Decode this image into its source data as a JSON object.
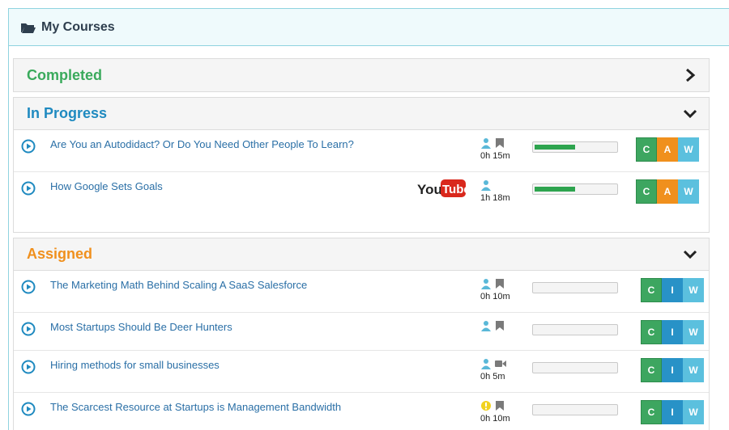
{
  "header": {
    "title": "My Courses"
  },
  "sections": {
    "completed": {
      "title": "Completed",
      "color": "#3aaa5c"
    },
    "in_progress": {
      "title": "In Progress",
      "color": "#1f8ac0",
      "rows": [
        {
          "title": "Are You an Autodidact? Or Do You Need Other People To Learn?",
          "duration": "0h 15m",
          "progress": 0.5,
          "buttons": [
            "C",
            "A",
            "W"
          ]
        },
        {
          "title": "How Google Sets Goals",
          "duration": "1h 18m",
          "progress": 0.5,
          "buttons": [
            "C",
            "A",
            "W"
          ],
          "youtube_label": {
            "you": "You",
            "tube": "Tube"
          }
        }
      ]
    },
    "assigned": {
      "title": "Assigned",
      "color": "#f0901d",
      "rows": [
        {
          "title": "The Marketing Math Behind Scaling A SaaS Salesforce",
          "duration": "0h 10m",
          "progress": 0,
          "buttons": [
            "C",
            "I",
            "W"
          ],
          "icon2": "bookmark-icon"
        },
        {
          "title": "Most Startups Should Be Deer Hunters",
          "duration": "",
          "progress": 0,
          "buttons": [
            "C",
            "I",
            "W"
          ],
          "icon2": "bookmark-icon"
        },
        {
          "title": "Hiring methods for small businesses",
          "duration": "0h 5m",
          "progress": 0,
          "buttons": [
            "C",
            "I",
            "W"
          ],
          "icon2": "video-camera-icon"
        },
        {
          "title": "The Scarcest Resource at Startups is Management Bandwidth",
          "duration": "0h 10m",
          "progress": 0,
          "buttons": [
            "C",
            "I",
            "W"
          ],
          "icon1": "warning-circle-icon",
          "icon2": "bookmark-icon"
        }
      ]
    }
  }
}
